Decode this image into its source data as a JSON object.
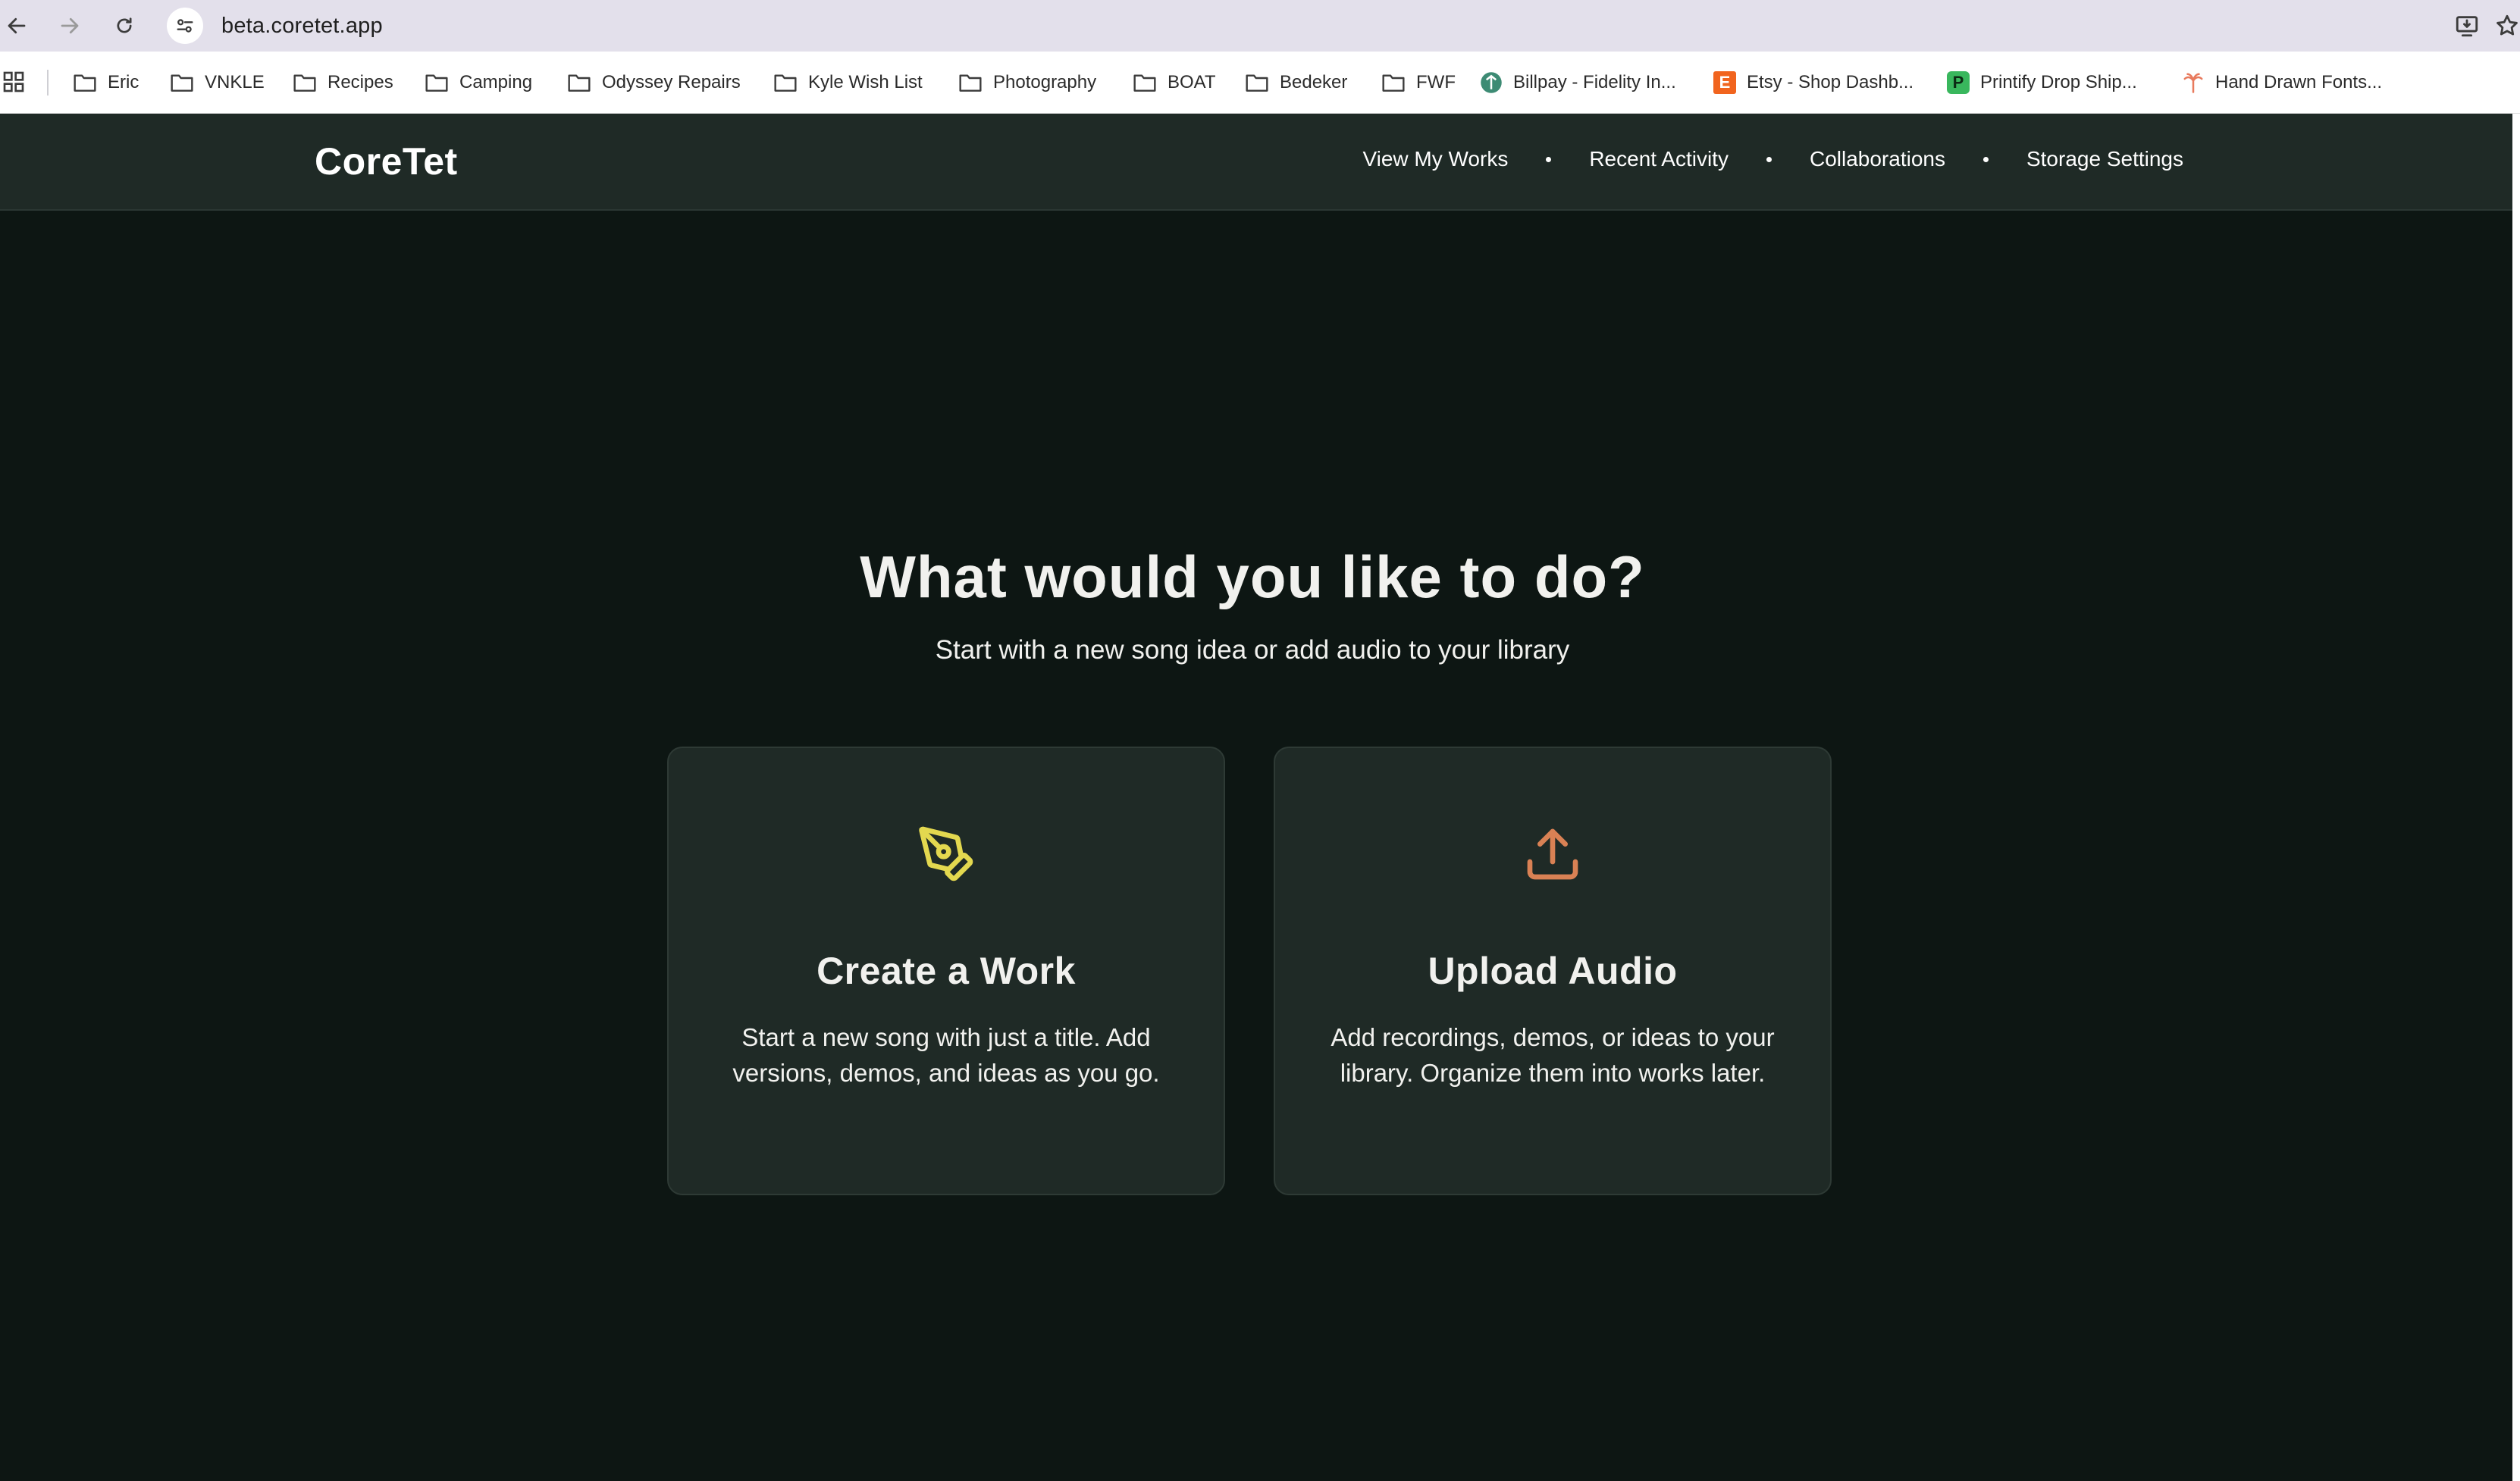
{
  "browser": {
    "url": "beta.coretet.app",
    "bookmarks": [
      {
        "label": "Eric",
        "type": "folder"
      },
      {
        "label": "VNKLE",
        "type": "folder"
      },
      {
        "label": "Recipes",
        "type": "folder"
      },
      {
        "label": "Camping",
        "type": "folder"
      },
      {
        "label": "Odyssey Repairs",
        "type": "folder"
      },
      {
        "label": "Kyle Wish List",
        "type": "folder"
      },
      {
        "label": "Photography",
        "type": "folder"
      },
      {
        "label": "BOAT",
        "type": "folder"
      },
      {
        "label": "Bedeker",
        "type": "folder"
      },
      {
        "label": "FWF",
        "type": "folder"
      },
      {
        "label": "Billpay - Fidelity In...",
        "type": "site",
        "icon": "fidelity-icon"
      },
      {
        "label": "Etsy - Shop Dashb...",
        "type": "site",
        "icon": "etsy-icon",
        "glyph": "E"
      },
      {
        "label": "Printify Drop Ship...",
        "type": "site",
        "icon": "printify-icon",
        "glyph": "P"
      },
      {
        "label": "Hand Drawn Fonts...",
        "type": "site",
        "icon": "palm-icon"
      }
    ]
  },
  "header": {
    "brand": "CoreTet",
    "nav": [
      "View My Works",
      "Recent Activity",
      "Collaborations",
      "Storage Settings"
    ]
  },
  "main": {
    "title": "What would you like to do?",
    "subtitle": "Start with a new song idea or add audio to your library",
    "cards": [
      {
        "icon": "pen-tool-icon",
        "title": "Create a Work",
        "description": "Start a new song with just a title. Add versions, demos, and ideas as you go."
      },
      {
        "icon": "upload-icon",
        "title": "Upload Audio",
        "description": "Add recordings, demos, or ideas to your library. Organize them into works later."
      }
    ]
  },
  "colors": {
    "background": "#0d1613",
    "surface": "#1f2a26",
    "text": "#f1f1ee",
    "create_icon": "#e3d84f",
    "upload_icon": "#d98154"
  }
}
